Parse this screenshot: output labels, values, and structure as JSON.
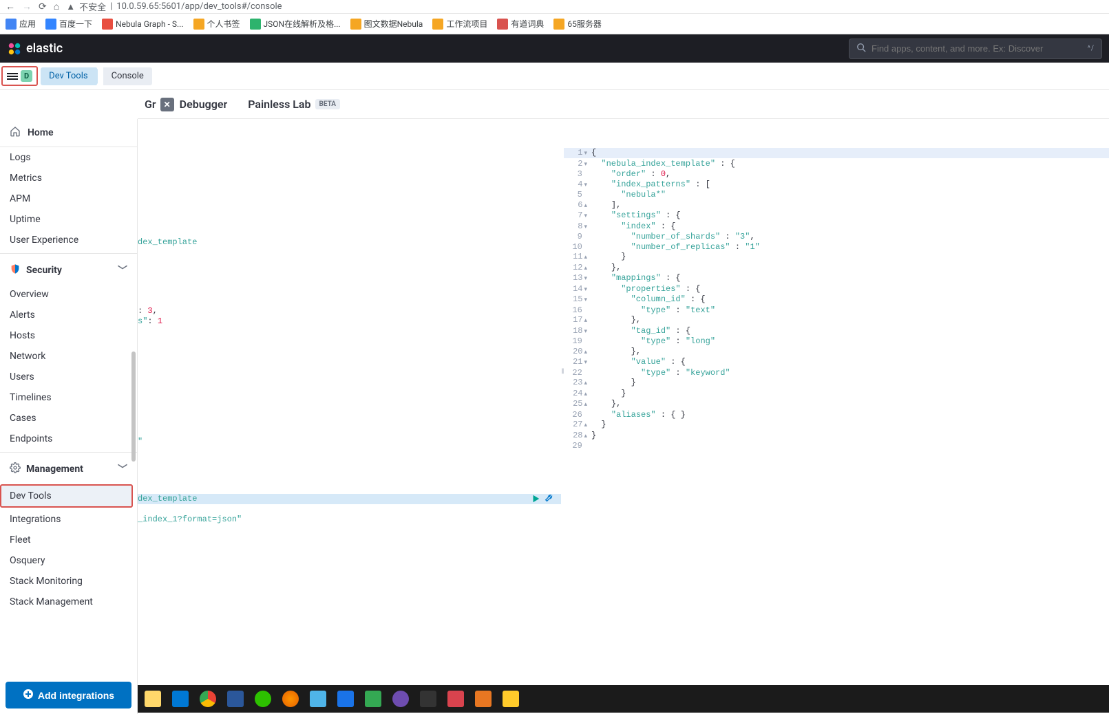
{
  "browser": {
    "security_label": "不安全",
    "url": "10.0.59.65:5601/app/dev_tools#/console"
  },
  "bookmarks": [
    {
      "label": "应用",
      "color": "#4285f4"
    },
    {
      "label": "百度一下",
      "color": "#3385ff"
    },
    {
      "label": "Nebula Graph - S...",
      "color": "#e84e40"
    },
    {
      "label": "个人书签",
      "color": "#f5a623"
    },
    {
      "label": "JSON在线解析及格...",
      "color": "#2db36d"
    },
    {
      "label": "图文数据Nebula",
      "color": "#f5a623"
    },
    {
      "label": "工作流项目",
      "color": "#f5a623"
    },
    {
      "label": "有道词典",
      "color": "#d9534f"
    },
    {
      "label": "65服务器",
      "color": "#f5a623"
    }
  ],
  "header": {
    "brand": "elastic",
    "search_placeholder": "Find apps, content, and more. Ex: Discover",
    "kbd_hint": "^/"
  },
  "breadcrumb": {
    "badge": "D",
    "first": "Dev Tools",
    "second": "Console"
  },
  "sidebar": {
    "home": "Home",
    "top_items": [
      "Logs",
      "Metrics",
      "APM",
      "Uptime",
      "User Experience"
    ],
    "security_header": "Security",
    "security_items": [
      "Overview",
      "Alerts",
      "Hosts",
      "Network",
      "Users",
      "Timelines",
      "Cases",
      "Endpoints"
    ],
    "management_header": "Management",
    "management_items": [
      "Dev Tools",
      "Integrations",
      "Fleet",
      "Osquery",
      "Stack Monitoring",
      "Stack Management"
    ],
    "add_integrations": "Add integrations"
  },
  "subnav": {
    "tab1_frag": "Gr",
    "tab1_suffix": "Debugger",
    "tab2": "Painless Lab",
    "beta": "BETA"
  },
  "left_editor": {
    "frag_line_130": "dex_template",
    "frag_line_230_a": ": 3,",
    "frag_line_230_b": "s\": 1",
    "frag_line_420": "\"",
    "frag_hl": "dex_template",
    "frag_line_535": "_index_1?format=json\""
  },
  "right_editor": {
    "lines": [
      {
        "n": "1",
        "fold": "▾",
        "txt": [
          {
            "t": "{",
            "c": "brace"
          }
        ]
      },
      {
        "n": "2",
        "fold": "▾",
        "txt": [
          {
            "t": "  ",
            "c": ""
          },
          {
            "t": "\"nebula_index_template\"",
            "c": "str"
          },
          {
            "t": " : {",
            "c": "brace"
          }
        ]
      },
      {
        "n": "3",
        "fold": "",
        "txt": [
          {
            "t": "    ",
            "c": ""
          },
          {
            "t": "\"order\"",
            "c": "str"
          },
          {
            "t": " : ",
            "c": "colon"
          },
          {
            "t": "0",
            "c": "lit"
          },
          {
            "t": ",",
            "c": "brace"
          }
        ]
      },
      {
        "n": "4",
        "fold": "▾",
        "txt": [
          {
            "t": "    ",
            "c": ""
          },
          {
            "t": "\"index_patterns\"",
            "c": "str"
          },
          {
            "t": " : [",
            "c": "brace"
          }
        ]
      },
      {
        "n": "5",
        "fold": "",
        "txt": [
          {
            "t": "      ",
            "c": ""
          },
          {
            "t": "\"nebula*\"",
            "c": "str"
          }
        ]
      },
      {
        "n": "6",
        "fold": "▴",
        "txt": [
          {
            "t": "    ",
            "c": ""
          },
          {
            "t": "],",
            "c": "brace"
          }
        ]
      },
      {
        "n": "7",
        "fold": "▾",
        "txt": [
          {
            "t": "    ",
            "c": ""
          },
          {
            "t": "\"settings\"",
            "c": "str"
          },
          {
            "t": " : {",
            "c": "brace"
          }
        ]
      },
      {
        "n": "8",
        "fold": "▾",
        "txt": [
          {
            "t": "      ",
            "c": ""
          },
          {
            "t": "\"index\"",
            "c": "str"
          },
          {
            "t": " : {",
            "c": "brace"
          }
        ]
      },
      {
        "n": "9",
        "fold": "",
        "txt": [
          {
            "t": "        ",
            "c": ""
          },
          {
            "t": "\"number_of_shards\"",
            "c": "str"
          },
          {
            "t": " : ",
            "c": "colon"
          },
          {
            "t": "\"3\"",
            "c": "str"
          },
          {
            "t": ",",
            "c": "brace"
          }
        ]
      },
      {
        "n": "10",
        "fold": "",
        "txt": [
          {
            "t": "        ",
            "c": ""
          },
          {
            "t": "\"number_of_replicas\"",
            "c": "str"
          },
          {
            "t": " : ",
            "c": "colon"
          },
          {
            "t": "\"1\"",
            "c": "str"
          }
        ]
      },
      {
        "n": "11",
        "fold": "▴",
        "txt": [
          {
            "t": "      ",
            "c": ""
          },
          {
            "t": "}",
            "c": "brace"
          }
        ]
      },
      {
        "n": "12",
        "fold": "▴",
        "txt": [
          {
            "t": "    ",
            "c": ""
          },
          {
            "t": "},",
            "c": "brace"
          }
        ]
      },
      {
        "n": "13",
        "fold": "▾",
        "txt": [
          {
            "t": "    ",
            "c": ""
          },
          {
            "t": "\"mappings\"",
            "c": "str"
          },
          {
            "t": " : {",
            "c": "brace"
          }
        ]
      },
      {
        "n": "14",
        "fold": "▾",
        "txt": [
          {
            "t": "      ",
            "c": ""
          },
          {
            "t": "\"properties\"",
            "c": "str"
          },
          {
            "t": " : {",
            "c": "brace"
          }
        ]
      },
      {
        "n": "15",
        "fold": "▾",
        "txt": [
          {
            "t": "        ",
            "c": ""
          },
          {
            "t": "\"column_id\"",
            "c": "str"
          },
          {
            "t": " : {",
            "c": "brace"
          }
        ]
      },
      {
        "n": "16",
        "fold": "",
        "txt": [
          {
            "t": "          ",
            "c": ""
          },
          {
            "t": "\"type\"",
            "c": "str"
          },
          {
            "t": " : ",
            "c": "colon"
          },
          {
            "t": "\"text\"",
            "c": "str"
          }
        ]
      },
      {
        "n": "17",
        "fold": "▴",
        "txt": [
          {
            "t": "        ",
            "c": ""
          },
          {
            "t": "},",
            "c": "brace"
          }
        ]
      },
      {
        "n": "18",
        "fold": "▾",
        "txt": [
          {
            "t": "        ",
            "c": ""
          },
          {
            "t": "\"tag_id\"",
            "c": "str"
          },
          {
            "t": " : {",
            "c": "brace"
          }
        ]
      },
      {
        "n": "19",
        "fold": "",
        "txt": [
          {
            "t": "          ",
            "c": ""
          },
          {
            "t": "\"type\"",
            "c": "str"
          },
          {
            "t": " : ",
            "c": "colon"
          },
          {
            "t": "\"long\"",
            "c": "str"
          }
        ]
      },
      {
        "n": "20",
        "fold": "▴",
        "txt": [
          {
            "t": "        ",
            "c": ""
          },
          {
            "t": "},",
            "c": "brace"
          }
        ]
      },
      {
        "n": "21",
        "fold": "▾",
        "txt": [
          {
            "t": "        ",
            "c": ""
          },
          {
            "t": "\"value\"",
            "c": "str"
          },
          {
            "t": " : {",
            "c": "brace"
          }
        ]
      },
      {
        "n": "22",
        "fold": "",
        "txt": [
          {
            "t": "          ",
            "c": ""
          },
          {
            "t": "\"type\"",
            "c": "str"
          },
          {
            "t": " : ",
            "c": "colon"
          },
          {
            "t": "\"keyword\"",
            "c": "str"
          }
        ]
      },
      {
        "n": "23",
        "fold": "▴",
        "txt": [
          {
            "t": "        ",
            "c": ""
          },
          {
            "t": "}",
            "c": "brace"
          }
        ]
      },
      {
        "n": "24",
        "fold": "▴",
        "txt": [
          {
            "t": "      ",
            "c": ""
          },
          {
            "t": "}",
            "c": "brace"
          }
        ]
      },
      {
        "n": "25",
        "fold": "▴",
        "txt": [
          {
            "t": "    ",
            "c": ""
          },
          {
            "t": "},",
            "c": "brace"
          }
        ]
      },
      {
        "n": "26",
        "fold": "",
        "txt": [
          {
            "t": "    ",
            "c": ""
          },
          {
            "t": "\"aliases\"",
            "c": "str"
          },
          {
            "t": " : { }",
            "c": "brace"
          }
        ]
      },
      {
        "n": "27",
        "fold": "▴",
        "txt": [
          {
            "t": "  ",
            "c": ""
          },
          {
            "t": "}",
            "c": "brace"
          }
        ]
      },
      {
        "n": "28",
        "fold": "▴",
        "txt": [
          {
            "t": "}",
            "c": "brace"
          }
        ]
      },
      {
        "n": "29",
        "fold": "",
        "txt": []
      }
    ]
  }
}
